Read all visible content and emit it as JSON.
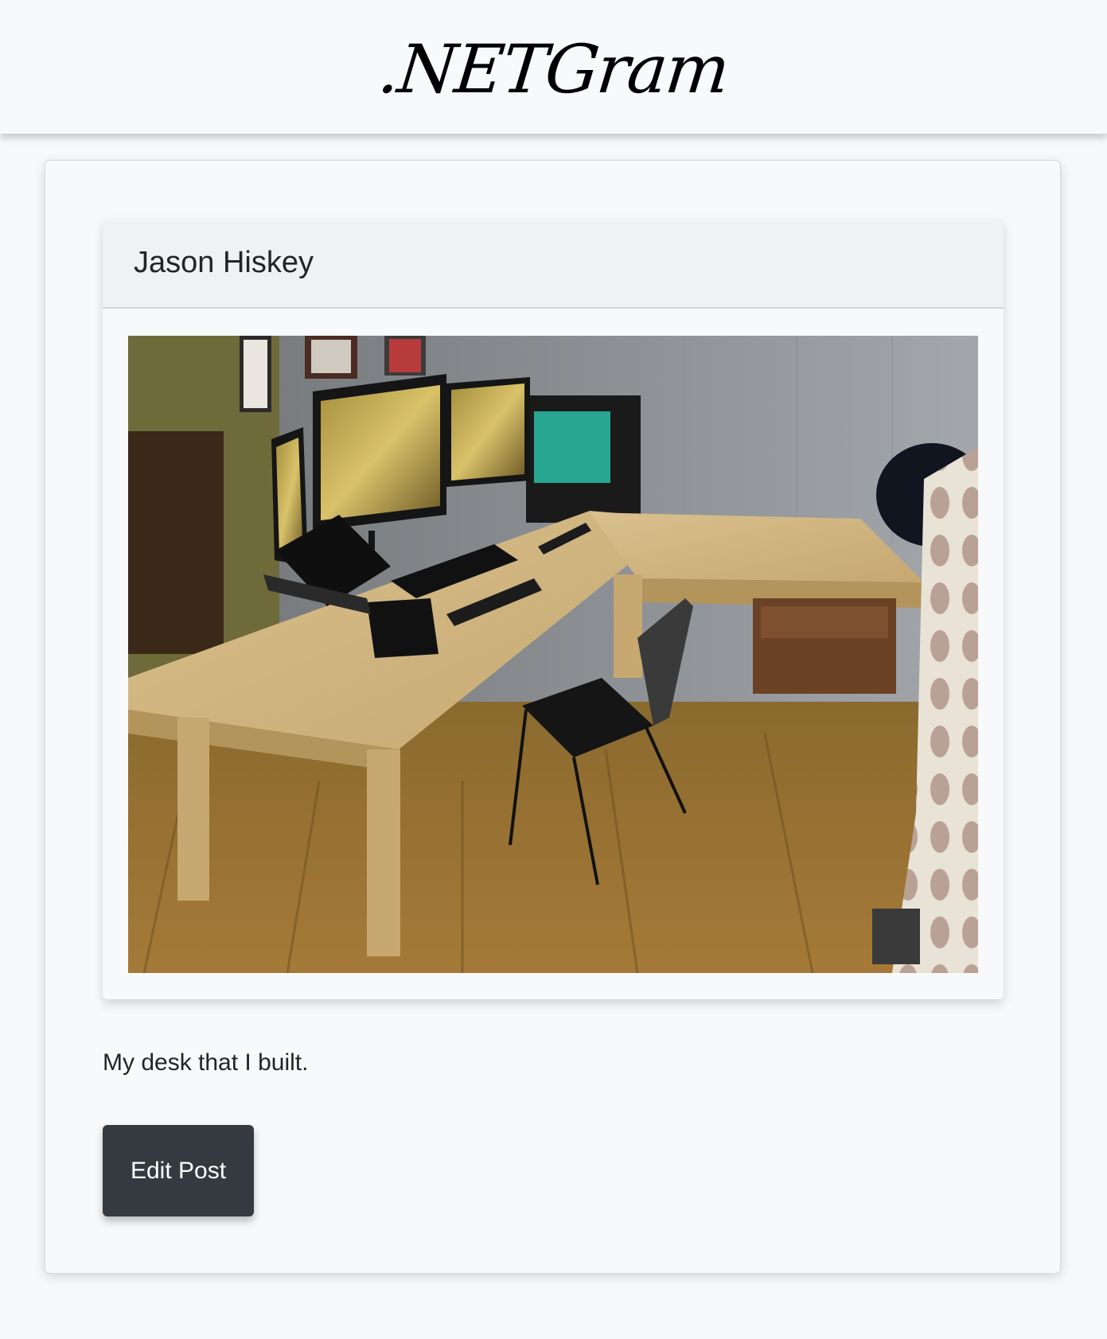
{
  "header": {
    "brand": ".NETGram"
  },
  "post": {
    "author": "Jason Hiskey",
    "image_alt": "Photo of an L-shaped wooden desk with monitors, a laptop stand, and a black chair",
    "caption": "My desk that I built."
  },
  "actions": {
    "edit_label": "Edit Post"
  },
  "colors": {
    "page_background": "#f8f9fa",
    "button_background": "#343a40",
    "button_text": "#ffffff"
  }
}
